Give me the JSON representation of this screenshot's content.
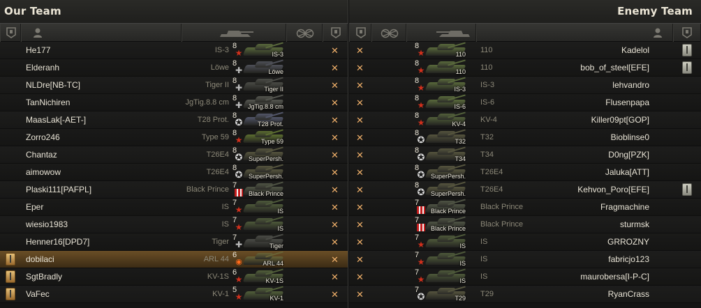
{
  "titles": {
    "our_team": "Our Team",
    "enemy_team": "Enemy Team"
  },
  "header_icons": [
    "medal-column-icon",
    "player-column-icon",
    "vehicle-column-icon",
    "frags-column-icon",
    "medal-column-icon"
  ],
  "our_team": [
    {
      "player": "He177",
      "vehicle": "IS-3",
      "tier": "8",
      "tank_label": "IS-3",
      "nation": "ussr",
      "color": "#5a6a3c",
      "medal": "",
      "self": false
    },
    {
      "player": "Elderanh",
      "vehicle": "Löwe",
      "tier": "8",
      "tank_label": "Löwe",
      "nation": "ger",
      "color": "#4e5058",
      "medal": "",
      "self": false
    },
    {
      "player": "NLDre[NB-TC]",
      "vehicle": "Tiger II",
      "tier": "8",
      "tank_label": "Tiger II",
      "nation": "ger",
      "color": "#4a4b46",
      "medal": "",
      "self": false
    },
    {
      "player": "TanNichiren",
      "vehicle": "JgTig.8.8 cm",
      "tier": "8",
      "tank_label": "JgTig.8.8 cm",
      "nation": "ger",
      "color": "#555650",
      "medal": "",
      "self": false
    },
    {
      "player": "MaasLak[-AET-]",
      "vehicle": "T28 Prot.",
      "tier": "8",
      "tank_label": "T28 Prot.",
      "nation": "usa",
      "color": "#52566a",
      "medal": "",
      "self": false
    },
    {
      "player": "Zorro246",
      "vehicle": "Type 59",
      "tier": "8",
      "tank_label": "Type 59",
      "nation": "ussr",
      "color": "#5c6e30",
      "medal": "",
      "self": false
    },
    {
      "player": "Chantaz",
      "vehicle": "T26E4",
      "tier": "8",
      "tank_label": "SuperPersh.",
      "nation": "usa",
      "color": "#56553e",
      "medal": "",
      "self": false
    },
    {
      "player": "aimowow",
      "vehicle": "T26E4",
      "tier": "8",
      "tank_label": "SuperPersh.",
      "nation": "usa",
      "color": "#56553e",
      "medal": "",
      "self": false
    },
    {
      "player": "Plaski111[PAFPL]",
      "vehicle": "Black Prince",
      "tier": "7",
      "tank_label": "Black Prince",
      "nation": "uk",
      "color": "#4f5444",
      "medal": "",
      "self": false
    },
    {
      "player": "Eper",
      "vehicle": "IS",
      "tier": "7",
      "tank_label": "IS",
      "nation": "ussr",
      "color": "#4e5a3a",
      "medal": "",
      "self": false
    },
    {
      "player": "wiesio1983",
      "vehicle": "IS",
      "tier": "7",
      "tank_label": "IS",
      "nation": "ussr",
      "color": "#4e5a3a",
      "medal": "",
      "self": false
    },
    {
      "player": "Henner16[DPD7]",
      "vehicle": "Tiger",
      "tier": "7",
      "tank_label": "Tiger",
      "nation": "ger",
      "color": "#4a4b46",
      "medal": "",
      "self": false
    },
    {
      "player": "dobilaci",
      "vehicle": "ARL 44",
      "tier": "6",
      "tank_label": "ARL 44",
      "nation": "fr",
      "color": "#6a6436",
      "medal": "gold",
      "self": true
    },
    {
      "player": "SgtBradly",
      "vehicle": "KV-1S",
      "tier": "6",
      "tank_label": "KV-1S",
      "nation": "ussr",
      "color": "#52603a",
      "medal": "gold",
      "self": false
    },
    {
      "player": "VaFec",
      "vehicle": "KV-1",
      "tier": "5",
      "tank_label": "KV-1",
      "nation": "ussr",
      "color": "#52603a",
      "medal": "gold",
      "self": false
    }
  ],
  "enemy_team": [
    {
      "player": "Kadelol",
      "vehicle": "110",
      "tier": "8",
      "tank_label": "110",
      "nation": "ussr",
      "color": "#5a6a3c",
      "medal": "silver"
    },
    {
      "player": "bob_of_steel[EFE]",
      "vehicle": "110",
      "tier": "8",
      "tank_label": "110",
      "nation": "ussr",
      "color": "#5a6a3c",
      "medal": "silver"
    },
    {
      "player": "lehvandro",
      "vehicle": "IS-3",
      "tier": "8",
      "tank_label": "IS-3",
      "nation": "ussr",
      "color": "#5a6a3c",
      "medal": ""
    },
    {
      "player": "Flusenpapa",
      "vehicle": "IS-6",
      "tier": "8",
      "tank_label": "IS-6",
      "nation": "ussr",
      "color": "#5a6a3c",
      "medal": ""
    },
    {
      "player": "Killer09pt[GOP]",
      "vehicle": "KV-4",
      "tier": "8",
      "tank_label": "KV-4",
      "nation": "ussr",
      "color": "#52603a",
      "medal": ""
    },
    {
      "player": "Bioblinse0",
      "vehicle": "T32",
      "tier": "8",
      "tank_label": "T32",
      "nation": "usa",
      "color": "#56553e",
      "medal": ""
    },
    {
      "player": "D0ng[PZK]",
      "vehicle": "T34",
      "tier": "8",
      "tank_label": "T34",
      "nation": "usa",
      "color": "#56553e",
      "medal": ""
    },
    {
      "player": "Jaluka[ATT]",
      "vehicle": "T26E4",
      "tier": "8",
      "tank_label": "SuperPersh.",
      "nation": "usa",
      "color": "#56553e",
      "medal": ""
    },
    {
      "player": "Kehvon_Poro[EFE]",
      "vehicle": "T26E4",
      "tier": "8",
      "tank_label": "SuperPersh.",
      "nation": "usa",
      "color": "#56553e",
      "medal": "silver"
    },
    {
      "player": "Fragmachine",
      "vehicle": "Black Prince",
      "tier": "7",
      "tank_label": "Black Prince",
      "nation": "uk",
      "color": "#4f5444",
      "medal": ""
    },
    {
      "player": "sturmsk",
      "vehicle": "Black Prince",
      "tier": "7",
      "tank_label": "Black Prince",
      "nation": "uk",
      "color": "#4f5444",
      "medal": ""
    },
    {
      "player": "GRROZNY",
      "vehicle": "IS",
      "tier": "7",
      "tank_label": "IS",
      "nation": "ussr",
      "color": "#4e5a3a",
      "medal": ""
    },
    {
      "player": "fabricjo123",
      "vehicle": "IS",
      "tier": "7",
      "tank_label": "IS",
      "nation": "ussr",
      "color": "#4e5a3a",
      "medal": ""
    },
    {
      "player": "maurobersa[I-P-C]",
      "vehicle": "IS",
      "tier": "7",
      "tank_label": "IS",
      "nation": "ussr",
      "color": "#4e5a3a",
      "medal": ""
    },
    {
      "player": "RyanCrass",
      "vehicle": "T29",
      "tier": "7",
      "tank_label": "T29",
      "nation": "usa",
      "color": "#56553e",
      "medal": ""
    }
  ],
  "status_mark": "✕"
}
